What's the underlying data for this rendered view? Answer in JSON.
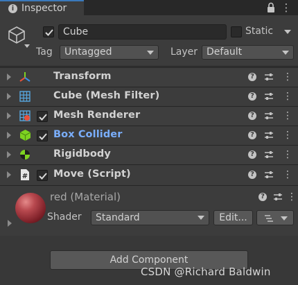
{
  "window": {
    "tab_label": "Inspector"
  },
  "object": {
    "name": "Cube",
    "active": true,
    "static_label": "Static",
    "static_checked": false,
    "tag_label": "Tag",
    "tag_value": "Untagged",
    "layer_label": "Layer",
    "layer_value": "Default"
  },
  "components": [
    {
      "name": "Transform",
      "icon": "transform-icon",
      "has_checkbox": false,
      "checked": false,
      "highlighted": false
    },
    {
      "name": "Cube (Mesh Filter)",
      "icon": "mesh-filter-icon",
      "has_checkbox": false,
      "checked": false,
      "highlighted": false
    },
    {
      "name": "Mesh Renderer",
      "icon": "mesh-renderer-icon",
      "has_checkbox": true,
      "checked": true,
      "highlighted": false
    },
    {
      "name": "Box Collider",
      "icon": "box-collider-icon",
      "has_checkbox": true,
      "checked": true,
      "highlighted": true
    },
    {
      "name": "Rigidbody",
      "icon": "rigidbody-icon",
      "has_checkbox": false,
      "checked": false,
      "highlighted": false
    },
    {
      "name": "Move (Script)",
      "icon": "script-icon",
      "has_checkbox": true,
      "checked": true,
      "highlighted": false
    }
  ],
  "material": {
    "title": "red (Material)",
    "shader_label": "Shader",
    "shader_value": "Standard",
    "edit_label": "Edit...",
    "preview_color": "#b8494f"
  },
  "footer": {
    "add_component_label": "Add Component"
  },
  "watermark": "CSDN @Richard Baldwin",
  "colors": {
    "accent": "#3a79bb",
    "highlight_text": "#7aaefc",
    "panel": "#3c3c3c"
  }
}
